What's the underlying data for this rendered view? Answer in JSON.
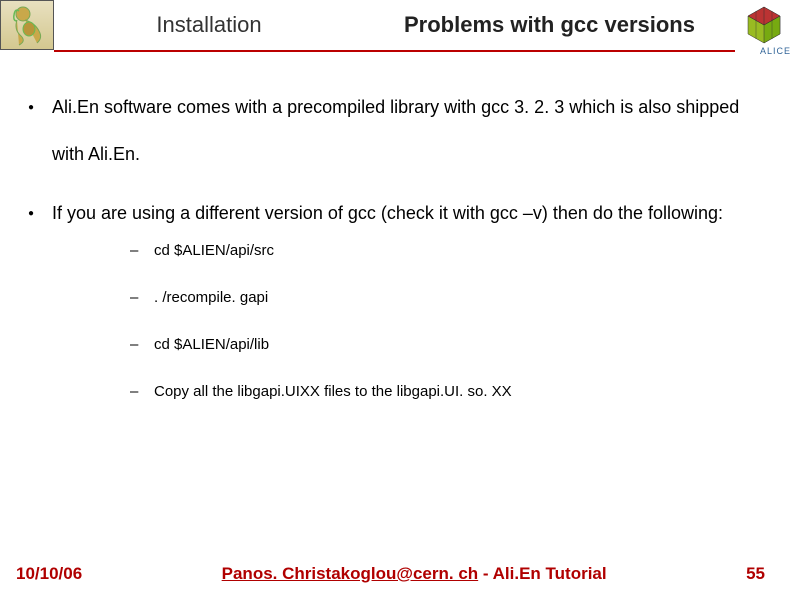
{
  "header": {
    "title_left": "Installation",
    "title_right": "Problems with gcc versions",
    "alice_label": "ALICE"
  },
  "bullets": {
    "item1": "Ali.En software comes with a precompiled library with gcc 3. 2. 3 which is also shipped with Ali.En.",
    "item2": "If you are using a different version of gcc (check it with gcc –v) then do the following:"
  },
  "sub_items": {
    "s1": "cd $ALIEN/api/src",
    "s2": ". /recompile. gapi",
    "s3": "cd $ALIEN/api/lib",
    "s4": "Copy all the libgapi.UIXX files to the libgapi.UI. so. XX"
  },
  "footer": {
    "date": "10/10/06",
    "email": "Panos. Christakoglou@cern. ch",
    "suffix": " - Ali.En Tutorial",
    "page": "55"
  }
}
